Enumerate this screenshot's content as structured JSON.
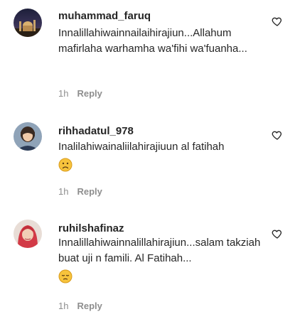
{
  "comments": [
    {
      "username": "muhammad_faruq",
      "text": "Innalillahiwainnailaihirajiun...Allahum mafirlaha warhamha wa'fihi wa'fuanha...",
      "time": "1h",
      "reply_label": "Reply",
      "avatar_icon": "avatar-photo"
    },
    {
      "username": "rihhadatul_978",
      "text": "Inalilahiwainaliilahirajiuun al fatihah",
      "time": "1h",
      "reply_label": "Reply",
      "emoji": "sad-face-emoji",
      "avatar_icon": "avatar-photo"
    },
    {
      "username": "ruhilshafinaz",
      "text": "Innalillahiwainnalillahirajiun...salam takziah buat uji n famili. Al Fatihah...",
      "time": "1h",
      "reply_label": "Reply",
      "emoji": "pensive-face-emoji",
      "avatar_icon": "avatar-photo"
    }
  ],
  "colors": {
    "text": "#262626",
    "meta": "#8e8e8e",
    "background": "#ffffff"
  }
}
